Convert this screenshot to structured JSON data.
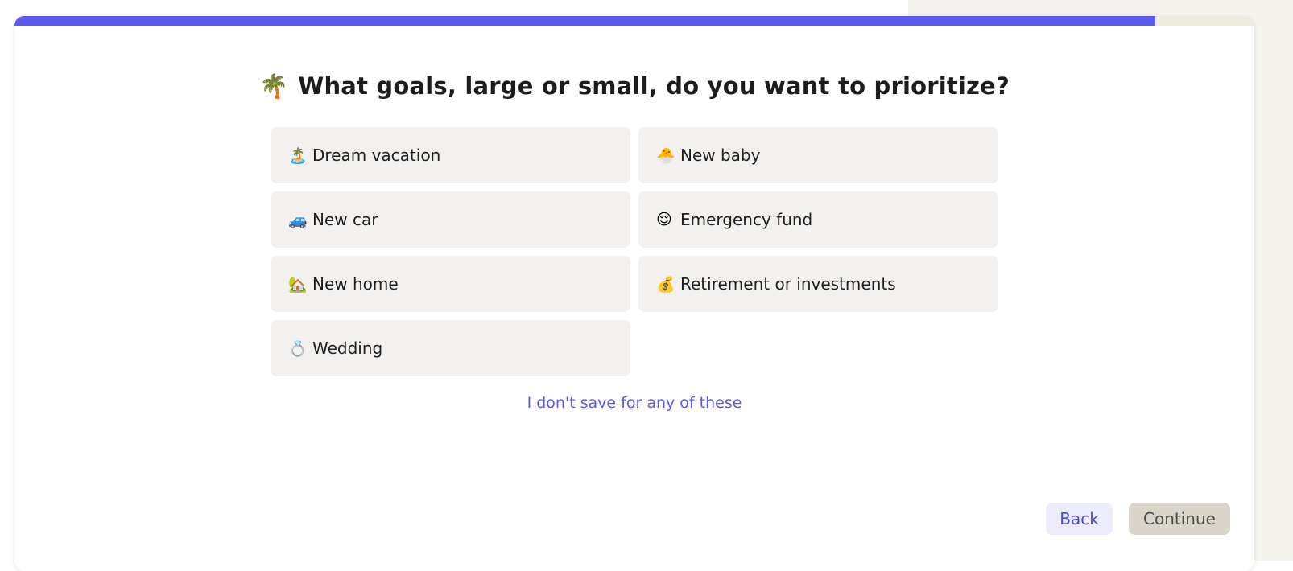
{
  "progress": {
    "fraction": 0.92,
    "fill_color": "#5a5af0",
    "track_color": "#f0ebe0"
  },
  "header": {
    "emoji": "🌴",
    "title": "What goals, large or small, do you want to prioritize?"
  },
  "options": [
    {
      "icon": "🏝️",
      "icon_name": "desert-island-icon",
      "label": "Dream vacation"
    },
    {
      "icon": "🐣",
      "icon_name": "hatching-chick-icon",
      "label": "New baby"
    },
    {
      "icon": "🚙",
      "icon_name": "car-icon",
      "label": "New car"
    },
    {
      "icon": "😌",
      "icon_name": "relieved-face-icon",
      "label": "Emergency fund"
    },
    {
      "icon": "🏡",
      "icon_name": "house-icon",
      "label": "New home"
    },
    {
      "icon": "💰",
      "icon_name": "money-bag-icon",
      "label": "Retirement or investments"
    },
    {
      "icon": "💍",
      "icon_name": "ring-icon",
      "label": "Wedding"
    }
  ],
  "skip_link": "I don't save for any of these",
  "footer": {
    "back_label": "Back",
    "continue_label": "Continue"
  },
  "colors": {
    "accent": "#5a5ae8",
    "option_bg": "#f2f1ef",
    "continue_bg": "#d9d5cb",
    "back_bg": "#ececfc"
  }
}
